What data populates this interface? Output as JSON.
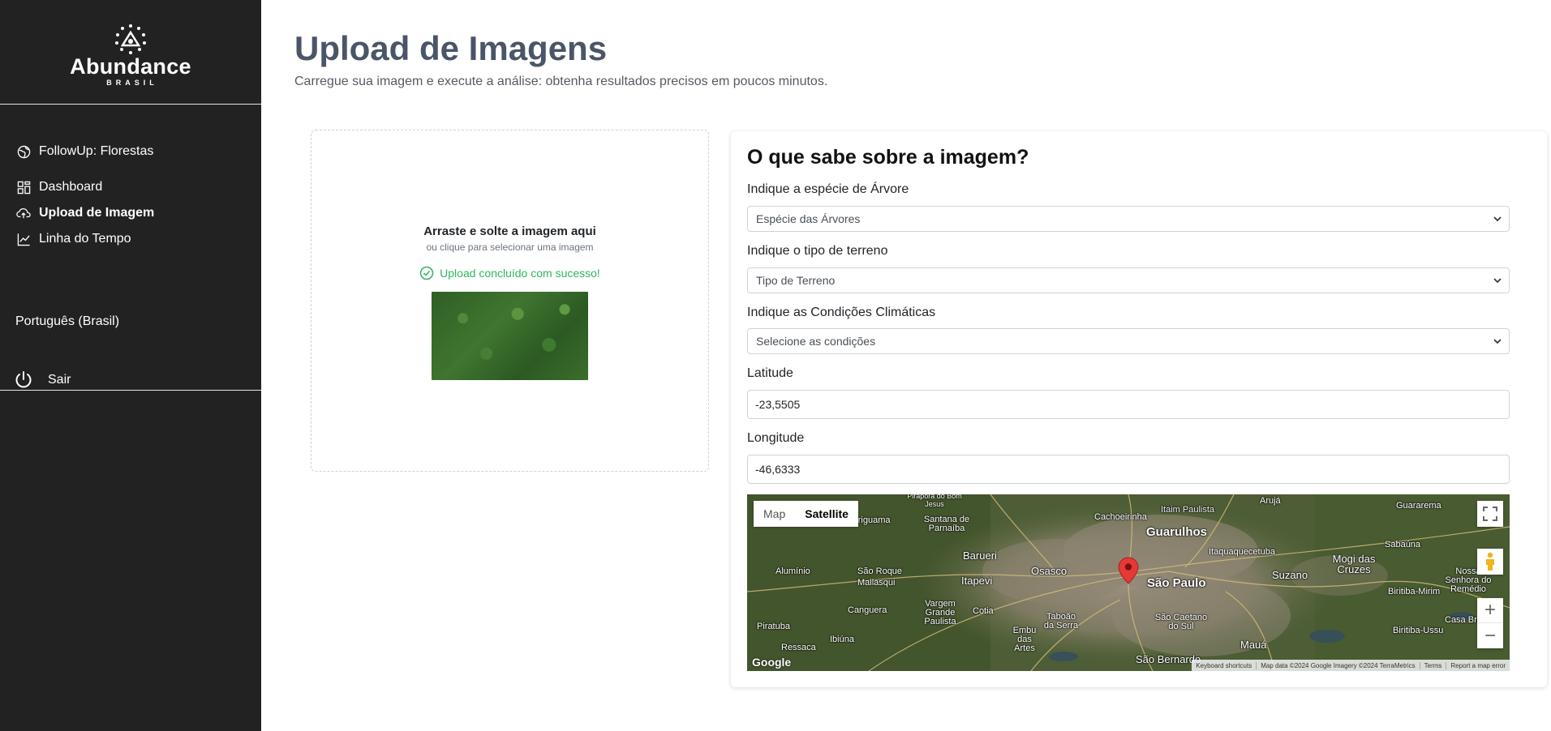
{
  "sidebar": {
    "logo_title": "Abundance",
    "logo_sub": "BRASIL",
    "items": [
      {
        "label": "FollowUp: Florestas"
      },
      {
        "label": "Dashboard"
      },
      {
        "label": "Upload de Imagem"
      },
      {
        "label": "Linha do Tempo"
      }
    ],
    "language": "Português (Brasil)",
    "logout": "Sair"
  },
  "page": {
    "title": "Upload de Imagens",
    "subtitle": "Carregue sua imagem e execute a análise: obtenha resultados precisos em poucos minutos."
  },
  "dropzone": {
    "title": "Arraste e solte a imagem aqui",
    "hint": "ou clique para selecionar uma imagem",
    "success": "Upload concluído com sucesso!"
  },
  "form": {
    "heading": "O que sabe sobre a imagem?",
    "species_label": "Indique a espécie de Árvore",
    "species_value": "Espécie das Árvores",
    "terrain_label": "Indique o tipo de terreno",
    "terrain_value": "Tipo de Terreno",
    "climate_label": "Indique as Condições Climáticas",
    "climate_value": "Selecione as condições",
    "latitude_label": "Latitude",
    "latitude_value": "-23,5505",
    "longitude_label": "Longitude",
    "longitude_value": "-46,6333"
  },
  "map": {
    "map_tab": "Map",
    "satellite_tab": "Satellite",
    "zoom_in": "+",
    "zoom_out": "−",
    "google": "Google",
    "attrib_shortcuts": "Keyboard shortcuts",
    "attrib_data": "Map data ©2024 Google Imagery ©2024 TerraMetrics",
    "attrib_terms": "Terms",
    "attrib_report": "Report a map error",
    "places": [
      {
        "name": "São Paulo",
        "size": "big"
      },
      {
        "name": "Guarulhos",
        "size": "big"
      },
      {
        "name": "Osasco",
        "size": "mid"
      },
      {
        "name": "Barueri",
        "size": "mid"
      },
      {
        "name": "Itapevi",
        "size": "mid"
      },
      {
        "name": "Suzano",
        "size": "mid"
      },
      {
        "name": "Mogi das Cruzes",
        "size": "mid"
      },
      {
        "name": "Mauá",
        "size": "mid"
      },
      {
        "name": "São Bernardo",
        "size": "mid"
      },
      {
        "name": "Cotia",
        "size": "small"
      },
      {
        "name": "Embu das Artes",
        "size": "small"
      },
      {
        "name": "Taboão da Serra",
        "size": "small"
      },
      {
        "name": "São Caetano do Sul",
        "size": "small"
      },
      {
        "name": "Itaquaquecetuba",
        "size": "small"
      },
      {
        "name": "Araçariguama",
        "size": "small"
      },
      {
        "name": "Santana de Parnaíba",
        "size": "small"
      },
      {
        "name": "Cachoeirinha",
        "size": "small"
      },
      {
        "name": "Itaim Paulista",
        "size": "small"
      },
      {
        "name": "Arujá",
        "size": "small"
      },
      {
        "name": "Guararema",
        "size": "small"
      },
      {
        "name": "Sabaúna",
        "size": "small"
      },
      {
        "name": "Nossa Senhora do Remédio",
        "size": "small"
      },
      {
        "name": "Biritiba-Mirim",
        "size": "small"
      },
      {
        "name": "Casa Branca",
        "size": "small"
      },
      {
        "name": "Biritiba-Ussu",
        "size": "small"
      },
      {
        "name": "Alumínio",
        "size": "small"
      },
      {
        "name": "São Roque",
        "size": "small"
      },
      {
        "name": "Mailasqui",
        "size": "small"
      },
      {
        "name": "Canguera",
        "size": "small"
      },
      {
        "name": "Vargem Grande Paulista",
        "size": "small"
      },
      {
        "name": "Piratuba",
        "size": "small"
      },
      {
        "name": "Ibiúna",
        "size": "small"
      },
      {
        "name": "Ressaca",
        "size": "small"
      },
      {
        "name": "Pirapora do Bom Jesus",
        "size": "small"
      }
    ]
  },
  "colors": {
    "sidebar_bg": "#222222",
    "title": "#4a5568",
    "success": "#2fb45f",
    "marker": "#e53935"
  }
}
